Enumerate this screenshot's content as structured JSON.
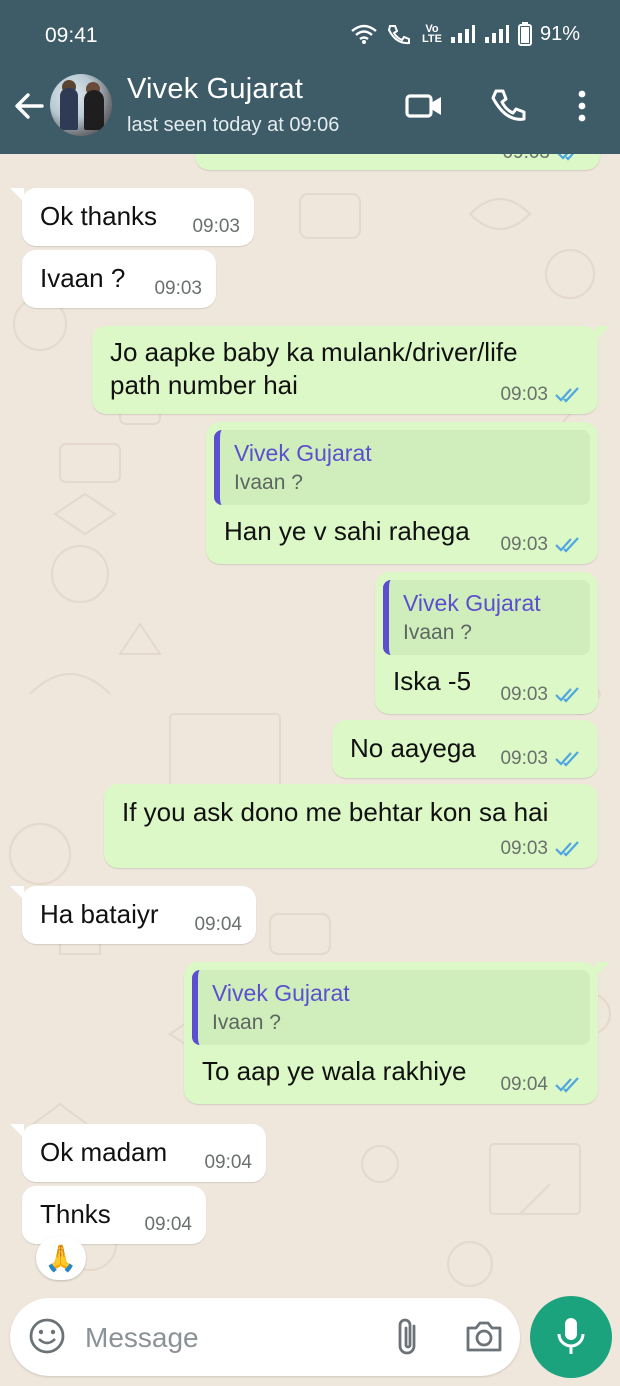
{
  "status_bar": {
    "time": "09:41",
    "battery": "91%",
    "network_label": "Vo LTE"
  },
  "header": {
    "contact_name": "Vivek Gujarat",
    "last_seen": "last seen today at 09:06"
  },
  "messages": [
    {
      "id": "m0",
      "direction": "out",
      "text": "",
      "time": "09:03",
      "status": "read",
      "partially_visible": true
    },
    {
      "id": "m1",
      "direction": "in",
      "text": "Ok thanks",
      "time": "09:03"
    },
    {
      "id": "m2",
      "direction": "in",
      "text": "Ivaan ?",
      "time": "09:03"
    },
    {
      "id": "m3",
      "direction": "out",
      "text_line1": "Jo aapke baby ka mulank/driver/life",
      "text_line2": "path number hai",
      "time": "09:03",
      "status": "read"
    },
    {
      "id": "m4",
      "direction": "out",
      "quote_name": "Vivek Gujarat",
      "quote_text": "Ivaan ?",
      "text": "Han ye v sahi rahega",
      "time": "09:03",
      "status": "read"
    },
    {
      "id": "m5",
      "direction": "out",
      "quote_name": "Vivek Gujarat",
      "quote_text": "Ivaan ?",
      "text": "Iska -5",
      "time": "09:03",
      "status": "read"
    },
    {
      "id": "m6",
      "direction": "out",
      "text": "No aayega",
      "time": "09:03",
      "status": "read"
    },
    {
      "id": "m7",
      "direction": "out",
      "text": "If you ask dono me behtar kon sa hai",
      "time": "09:03",
      "status": "read"
    },
    {
      "id": "m8",
      "direction": "in",
      "text": "Ha bataiyr",
      "time": "09:04"
    },
    {
      "id": "m9",
      "direction": "out",
      "quote_name": "Vivek Gujarat",
      "quote_text": "Ivaan ?",
      "text": "To aap ye wala rakhiye",
      "time": "09:04",
      "status": "read"
    },
    {
      "id": "m10",
      "direction": "in",
      "text": "Ok madam",
      "time": "09:04"
    },
    {
      "id": "m11",
      "direction": "in",
      "text": "Thnks",
      "time": "09:04",
      "reaction": "🙏"
    }
  ],
  "composer": {
    "placeholder": "Message"
  },
  "colors": {
    "header_bg": "#3e5b68",
    "chat_bg": "#efe7dc",
    "incoming_bubble": "#ffffff",
    "outgoing_bubble": "#dbf8c6",
    "read_tick": "#4fa6e0",
    "quote_accent": "#5b4fcf",
    "mic_button": "#1ba37d"
  },
  "icons": {
    "header": [
      "back-arrow-icon",
      "video-call-icon",
      "voice-call-icon",
      "more-options-icon"
    ],
    "composer": [
      "emoji-icon",
      "attach-icon",
      "camera-icon",
      "mic-icon"
    ]
  }
}
